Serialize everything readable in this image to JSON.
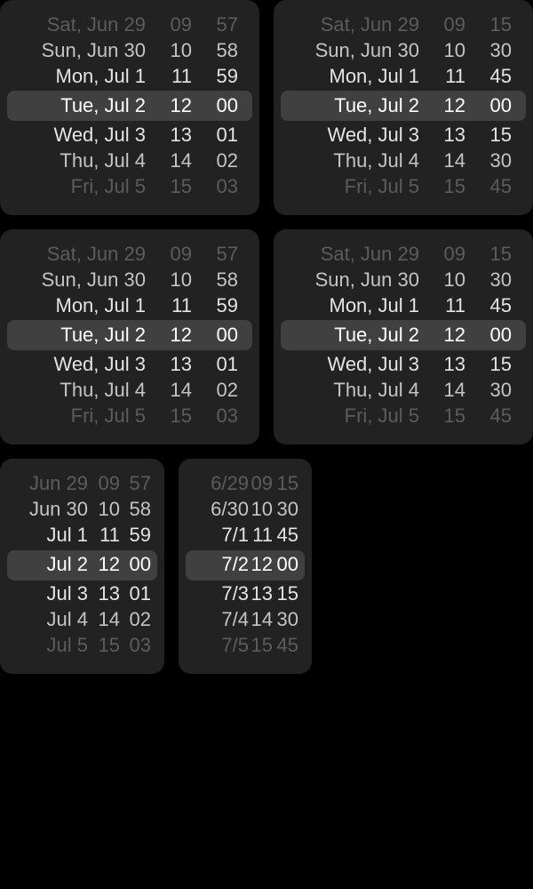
{
  "pickers": [
    {
      "rows": [
        {
          "date": "Sat, Jun 29",
          "hour": "09",
          "minute": "57"
        },
        {
          "date": "Sun, Jun 30",
          "hour": "10",
          "minute": "58"
        },
        {
          "date": "Mon, Jul 1",
          "hour": "11",
          "minute": "59"
        },
        {
          "date": "Tue, Jul 2",
          "hour": "12",
          "minute": "00"
        },
        {
          "date": "Wed, Jul 3",
          "hour": "13",
          "minute": "01"
        },
        {
          "date": "Thu, Jul 4",
          "hour": "14",
          "minute": "02"
        },
        {
          "date": "Fri, Jul 5",
          "hour": "15",
          "minute": "03"
        }
      ]
    },
    {
      "rows": [
        {
          "date": "Sat, Jun 29",
          "hour": "09",
          "minute": "15"
        },
        {
          "date": "Sun, Jun 30",
          "hour": "10",
          "minute": "30"
        },
        {
          "date": "Mon, Jul 1",
          "hour": "11",
          "minute": "45"
        },
        {
          "date": "Tue, Jul 2",
          "hour": "12",
          "minute": "00"
        },
        {
          "date": "Wed, Jul 3",
          "hour": "13",
          "minute": "15"
        },
        {
          "date": "Thu, Jul 4",
          "hour": "14",
          "minute": "30"
        },
        {
          "date": "Fri, Jul 5",
          "hour": "15",
          "minute": "45"
        }
      ]
    },
    {
      "rows": [
        {
          "date": "Sat, Jun 29",
          "hour": "09",
          "minute": "57"
        },
        {
          "date": "Sun, Jun 30",
          "hour": "10",
          "minute": "58"
        },
        {
          "date": "Mon, Jul 1",
          "hour": "11",
          "minute": "59"
        },
        {
          "date": "Tue, Jul 2",
          "hour": "12",
          "minute": "00"
        },
        {
          "date": "Wed, Jul 3",
          "hour": "13",
          "minute": "01"
        },
        {
          "date": "Thu, Jul 4",
          "hour": "14",
          "minute": "02"
        },
        {
          "date": "Fri, Jul 5",
          "hour": "15",
          "minute": "03"
        }
      ]
    },
    {
      "rows": [
        {
          "date": "Sat, Jun 29",
          "hour": "09",
          "minute": "15"
        },
        {
          "date": "Sun, Jun 30",
          "hour": "10",
          "minute": "30"
        },
        {
          "date": "Mon, Jul 1",
          "hour": "11",
          "minute": "45"
        },
        {
          "date": "Tue, Jul 2",
          "hour": "12",
          "minute": "00"
        },
        {
          "date": "Wed, Jul 3",
          "hour": "13",
          "minute": "15"
        },
        {
          "date": "Thu, Jul 4",
          "hour": "14",
          "minute": "30"
        },
        {
          "date": "Fri, Jul 5",
          "hour": "15",
          "minute": "45"
        }
      ]
    },
    {
      "rows": [
        {
          "date": "Jun 29",
          "hour": "09",
          "minute": "57"
        },
        {
          "date": "Jun 30",
          "hour": "10",
          "minute": "58"
        },
        {
          "date": "Jul 1",
          "hour": "11",
          "minute": "59"
        },
        {
          "date": "Jul 2",
          "hour": "12",
          "minute": "00"
        },
        {
          "date": "Jul 3",
          "hour": "13",
          "minute": "01"
        },
        {
          "date": "Jul 4",
          "hour": "14",
          "minute": "02"
        },
        {
          "date": "Jul 5",
          "hour": "15",
          "minute": "03"
        }
      ]
    },
    {
      "rows": [
        {
          "date": "6/29",
          "hour": "09",
          "minute": "15"
        },
        {
          "date": "6/30",
          "hour": "10",
          "minute": "30"
        },
        {
          "date": "7/1",
          "hour": "11",
          "minute": "45"
        },
        {
          "date": "7/2",
          "hour": "12",
          "minute": "00"
        },
        {
          "date": "7/3",
          "hour": "13",
          "minute": "15"
        },
        {
          "date": "7/4",
          "hour": "14",
          "minute": "30"
        },
        {
          "date": "7/5",
          "hour": "15",
          "minute": "45"
        }
      ]
    }
  ],
  "selected_row_index": 3,
  "colors": {
    "background": "#000000",
    "picker_background": "#222222",
    "selection_highlight": "#404040",
    "selected_text": "#ffffff",
    "faded_text": "#5c5c5c"
  }
}
